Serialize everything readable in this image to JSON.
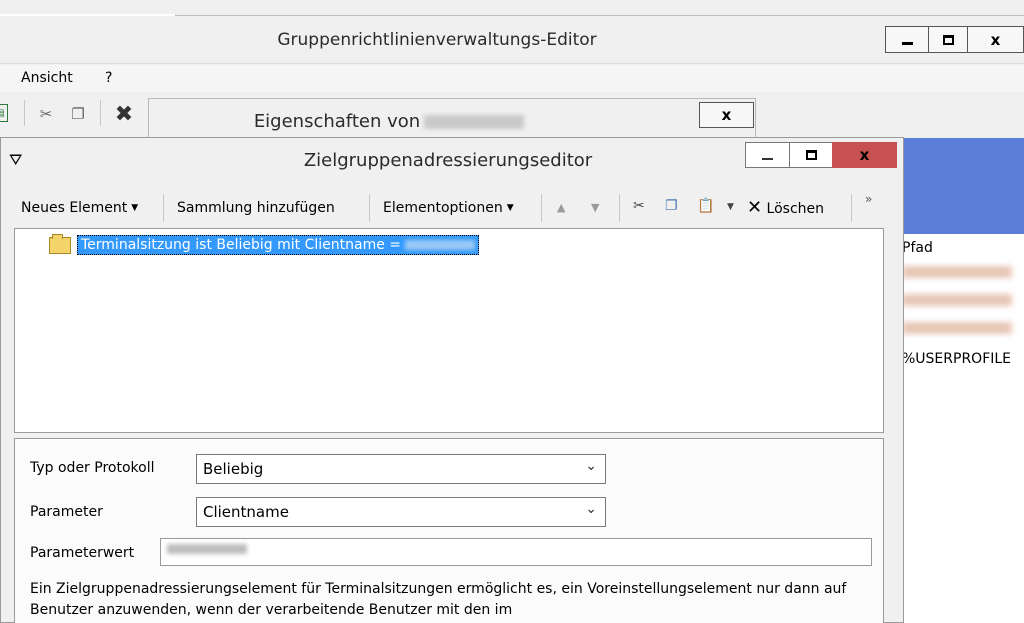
{
  "main_window": {
    "title": "Gruppenrichtlinienverwaltungs-Editor",
    "close_label": "x"
  },
  "menu": {
    "items": [
      "Ansicht",
      "?"
    ]
  },
  "properties_dialog": {
    "title": "Eigenschaften von",
    "close_label": "x"
  },
  "editor": {
    "title": "Zielgruppenadressierungseditor",
    "close_label": "x",
    "toolbar": {
      "new_item": "Neues Element",
      "add_collection": "Sammlung hinzufügen",
      "item_options": "Elementoptionen",
      "delete": "Löschen",
      "more": "»"
    },
    "tree": {
      "item_label": "Terminalsitzung ist Beliebig mit Clientname ="
    },
    "properties": {
      "type_label": "Typ oder Protokoll",
      "type_value": "Beliebig",
      "param_label": "Parameter",
      "param_value": "Clientname",
      "paramval_label": "Parameterwert",
      "description": "Ein Zielgruppenadressierungselement für Terminalsitzungen ermöglicht es, ein Voreinstellungselement nur dann auf Benutzer anzuwenden, wenn der verarbeitende Benutzer mit den im"
    }
  },
  "right_list": {
    "header": "Pfad",
    "last_row": "%USERPROFILE"
  },
  "colors": {
    "selection": "#3399ff",
    "close_red": "#c75050",
    "side_blue": "#5b7fd9"
  }
}
